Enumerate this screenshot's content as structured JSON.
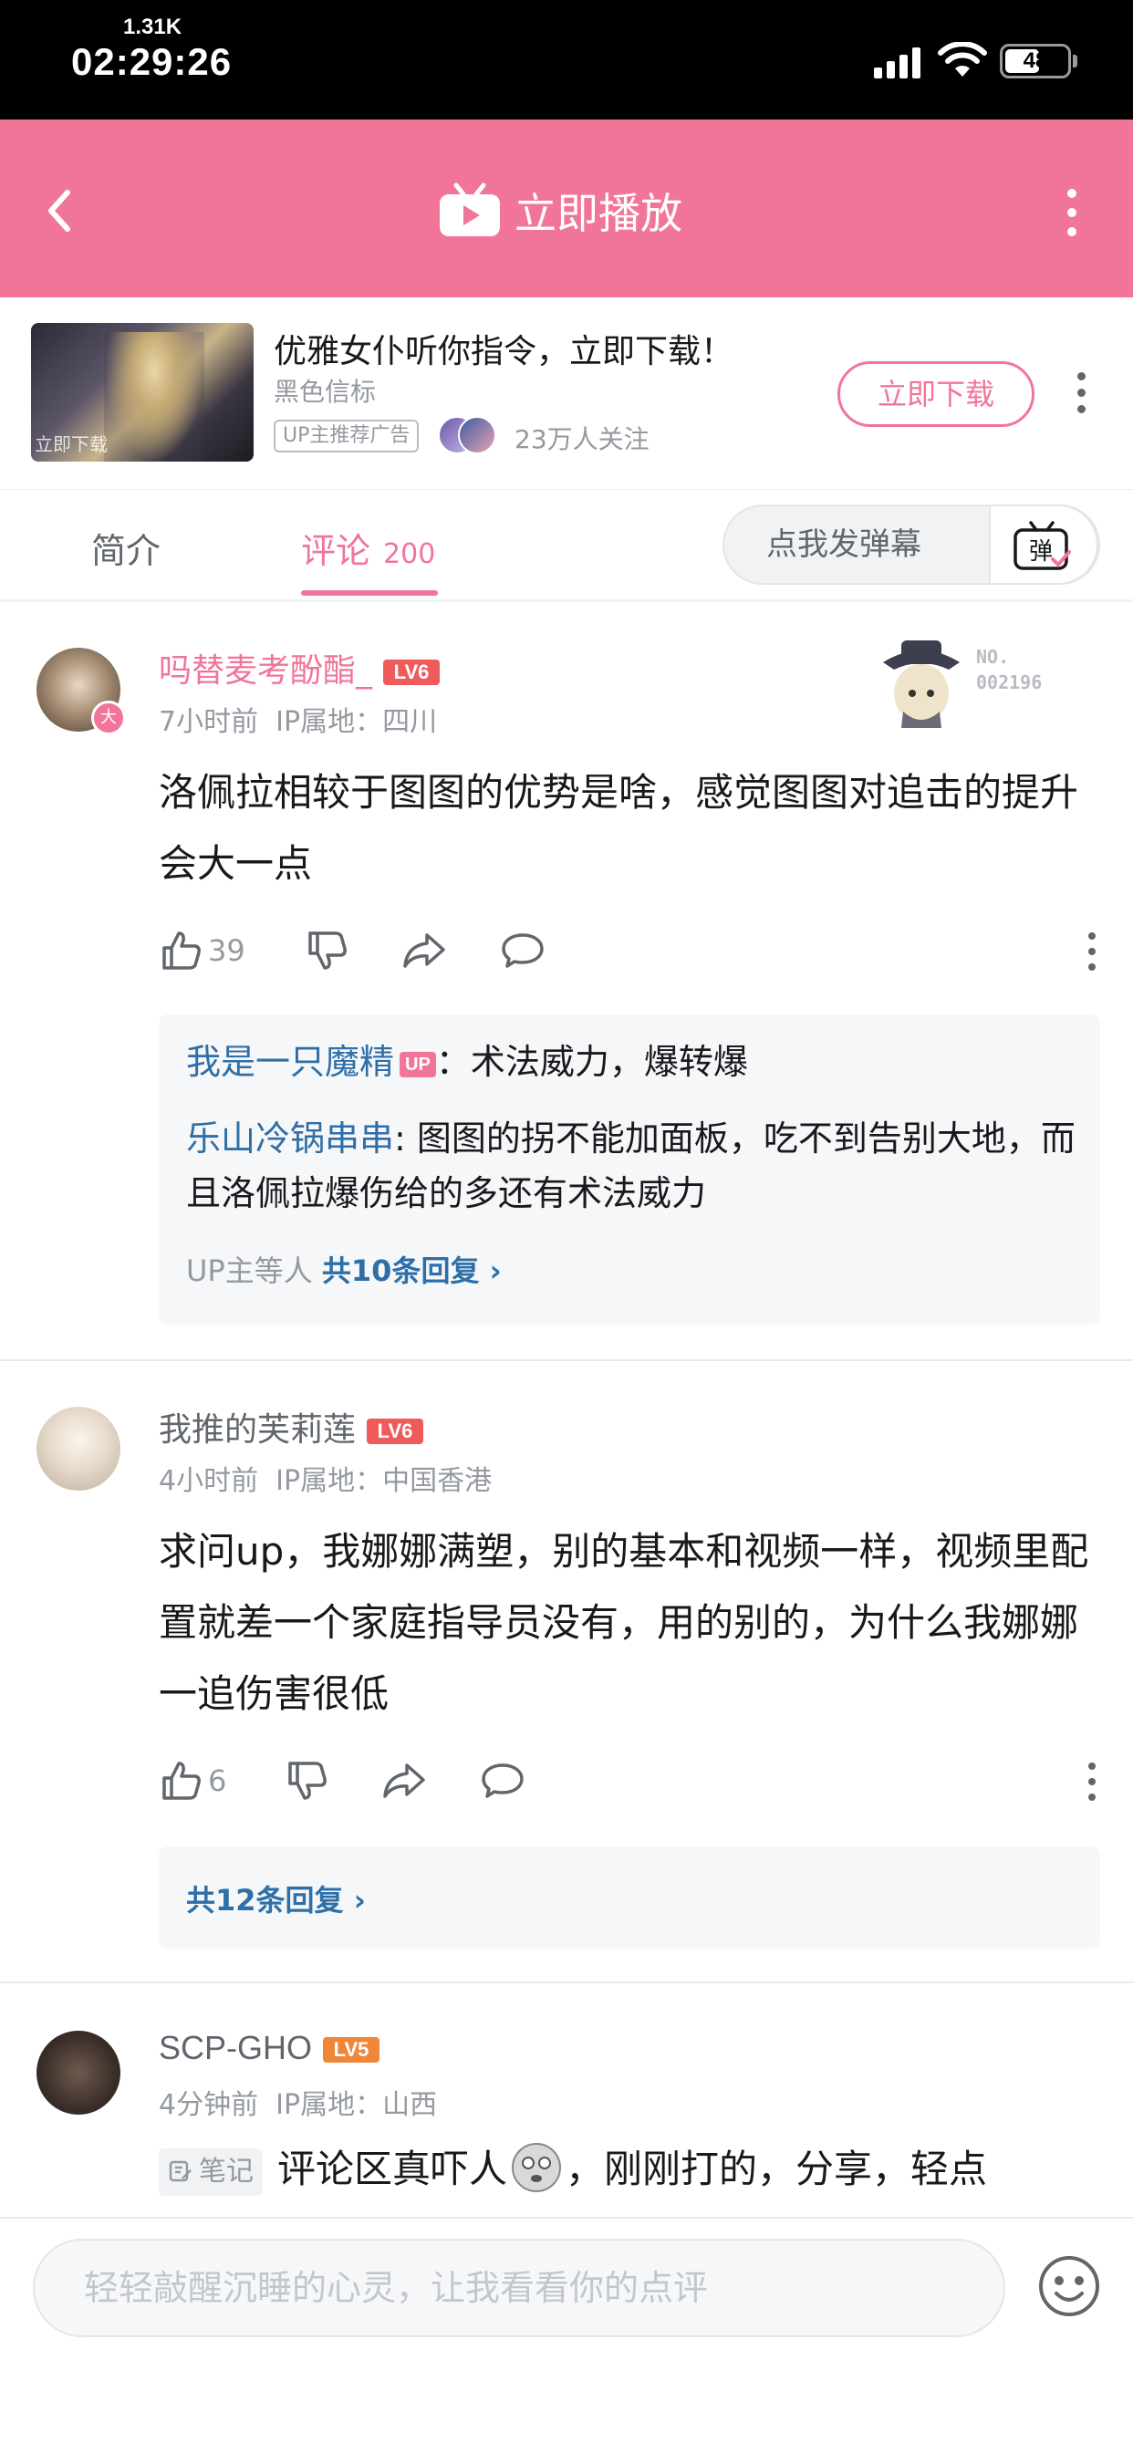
{
  "status_bar": {
    "net_speed": "1.31K",
    "time": "02:29:26",
    "battery": "48"
  },
  "header": {
    "title": "立即播放"
  },
  "ad": {
    "thumb_caption": "立即下载",
    "title": "优雅女仆听你指令，立即下载！",
    "subtitle": "黑色信标",
    "tag": "UP主推荐广告",
    "followers": "23万人关注",
    "button": "立即下载"
  },
  "tabs": {
    "intro": "简介",
    "comments": "评论",
    "comments_count": "200",
    "danmaku_placeholder": "点我发弹幕",
    "danmaku_icon_text": "弹"
  },
  "comments": [
    {
      "user": "吗替麦考酚酯_",
      "level": "LV6",
      "avatar_badge": "大",
      "time": "7小时前",
      "ip_label": "IP属地：",
      "ip": "四川",
      "badge_no": "NO.",
      "badge_num": "002196",
      "text": "洛佩拉相较于图图的优势是啥，感觉图图对追击的提升会大一点",
      "likes": "39",
      "replies": [
        {
          "name": "我是一只魔精",
          "up_tag": "UP",
          "text": "：术法威力，爆转爆"
        },
        {
          "name": "乐山冷锅串串",
          "text": ": 图图的拐不能加面板，吃不到告别大地，而且洛佩拉爆伤给的多还有术法威力"
        }
      ],
      "reply_prefix": "UP主等人",
      "reply_total": "共10条回复"
    },
    {
      "user": "我推的芙莉莲",
      "level": "LV6",
      "time": "4小时前",
      "ip_label": "IP属地：",
      "ip": "中国香港",
      "text": "求问up，我娜娜满塑，别的基本和视频一样，视频里配置就差一个家庭指导员没有，用的别的，为什么我娜娜一追伤害很低",
      "likes": "6",
      "reply_total": "共12条回复"
    },
    {
      "user": "SCP-GHO",
      "level": "LV5",
      "time": "4分钟前",
      "ip_label": "IP属地：",
      "ip": "山西",
      "note_tag": "笔记",
      "text_a": "评论区真吓人",
      "text_b": "，刚刚打的，分享，轻点"
    }
  ],
  "input": {
    "placeholder": "轻轻敲醒沉睡的心灵，让我看看你的点评"
  },
  "colors": {
    "accent": "#f17599",
    "link": "#2f6fa8",
    "lv6": "#ef5b5b",
    "lv5": "#f0863a"
  }
}
